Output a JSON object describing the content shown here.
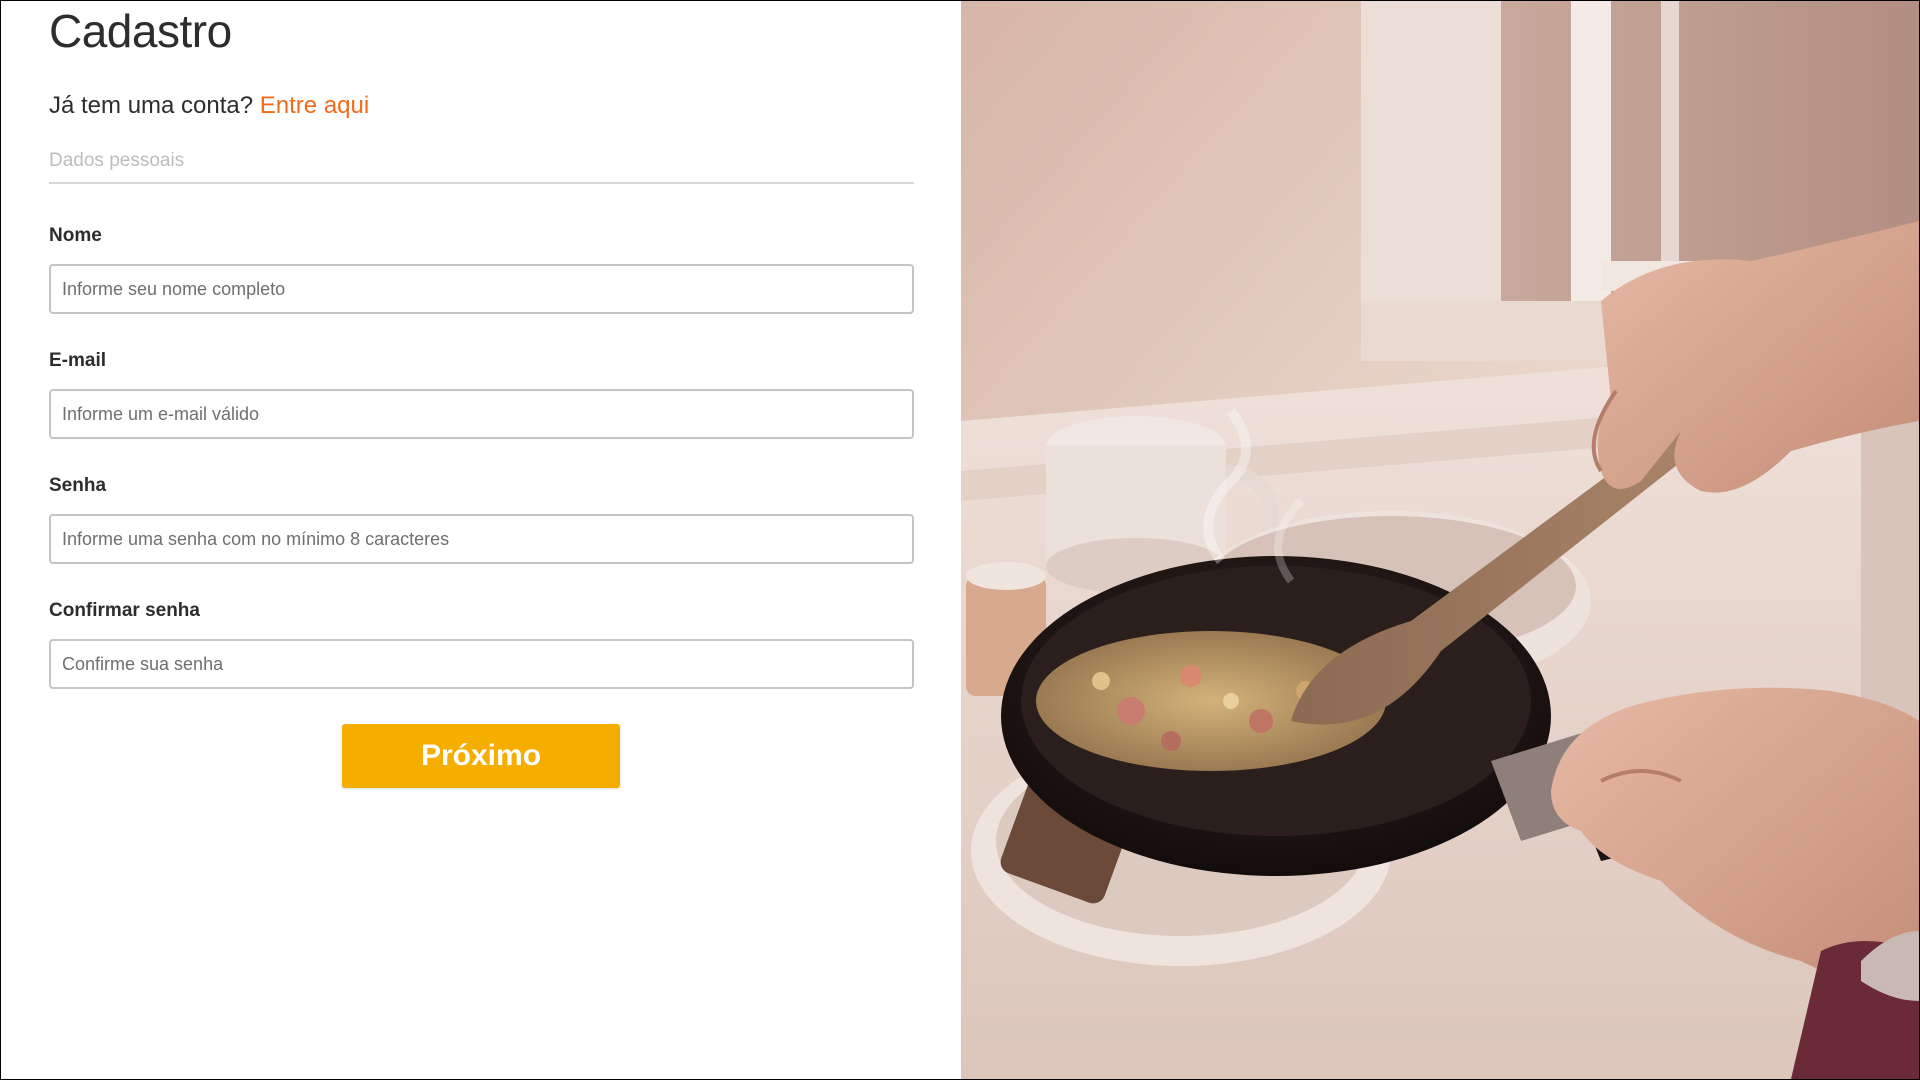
{
  "form": {
    "title": "Cadastro",
    "login_prompt": "Já tem uma conta?",
    "login_link": "Entre aqui",
    "section_label": "Dados pessoais",
    "fields": [
      {
        "label": "Nome",
        "placeholder": "Informe seu nome completo",
        "value": ""
      },
      {
        "label": "E-mail",
        "placeholder": "Informe um e-mail válido",
        "value": ""
      },
      {
        "label": "Senha",
        "placeholder": "Informe uma senha com no mínimo 8 caracteres",
        "value": ""
      },
      {
        "label": "Confirmar senha",
        "placeholder": "Confirme sua senha",
        "value": ""
      }
    ],
    "next_button": "Próximo"
  },
  "colors": {
    "accent_link": "#f26a1b",
    "button": "#f5ad00",
    "text": "#2d2d2d"
  },
  "icons": {
    "photo": "cooking-pan-photo"
  }
}
